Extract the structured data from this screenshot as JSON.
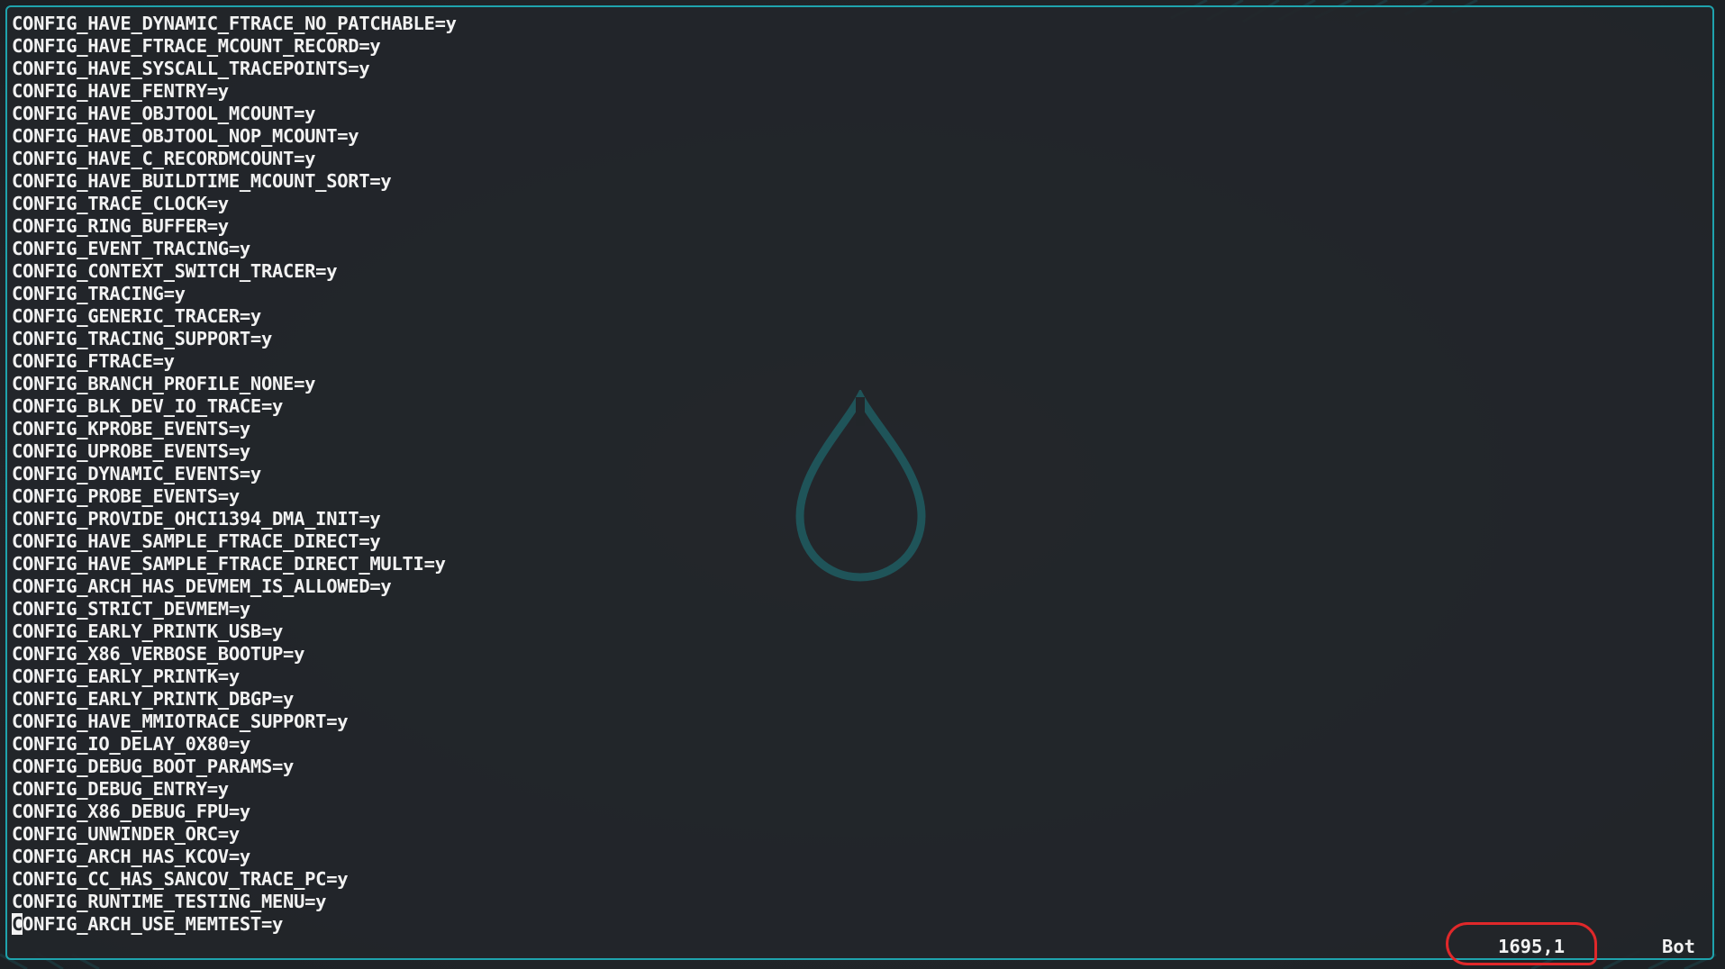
{
  "editor": {
    "lines": [
      "CONFIG_HAVE_DYNAMIC_FTRACE_NO_PATCHABLE=y",
      "CONFIG_HAVE_FTRACE_MCOUNT_RECORD=y",
      "CONFIG_HAVE_SYSCALL_TRACEPOINTS=y",
      "CONFIG_HAVE_FENTRY=y",
      "CONFIG_HAVE_OBJTOOL_MCOUNT=y",
      "CONFIG_HAVE_OBJTOOL_NOP_MCOUNT=y",
      "CONFIG_HAVE_C_RECORDMCOUNT=y",
      "CONFIG_HAVE_BUILDTIME_MCOUNT_SORT=y",
      "CONFIG_TRACE_CLOCK=y",
      "CONFIG_RING_BUFFER=y",
      "CONFIG_EVENT_TRACING=y",
      "CONFIG_CONTEXT_SWITCH_TRACER=y",
      "CONFIG_TRACING=y",
      "CONFIG_GENERIC_TRACER=y",
      "CONFIG_TRACING_SUPPORT=y",
      "CONFIG_FTRACE=y",
      "CONFIG_BRANCH_PROFILE_NONE=y",
      "CONFIG_BLK_DEV_IO_TRACE=y",
      "CONFIG_KPROBE_EVENTS=y",
      "CONFIG_UPROBE_EVENTS=y",
      "CONFIG_DYNAMIC_EVENTS=y",
      "CONFIG_PROBE_EVENTS=y",
      "CONFIG_PROVIDE_OHCI1394_DMA_INIT=y",
      "CONFIG_HAVE_SAMPLE_FTRACE_DIRECT=y",
      "CONFIG_HAVE_SAMPLE_FTRACE_DIRECT_MULTI=y",
      "CONFIG_ARCH_HAS_DEVMEM_IS_ALLOWED=y",
      "CONFIG_STRICT_DEVMEM=y",
      "CONFIG_EARLY_PRINTK_USB=y",
      "CONFIG_X86_VERBOSE_BOOTUP=y",
      "CONFIG_EARLY_PRINTK=y",
      "CONFIG_EARLY_PRINTK_DBGP=y",
      "CONFIG_HAVE_MMIOTRACE_SUPPORT=y",
      "CONFIG_IO_DELAY_0X80=y",
      "CONFIG_DEBUG_BOOT_PARAMS=y",
      "CONFIG_DEBUG_ENTRY=y",
      "CONFIG_X86_DEBUG_FPU=y",
      "CONFIG_UNWINDER_ORC=y",
      "CONFIG_ARCH_HAS_KCOV=y",
      "CONFIG_CC_HAS_SANCOV_TRACE_PC=y",
      "CONFIG_RUNTIME_TESTING_MENU=y"
    ],
    "cursor_line": {
      "cursor_char": "C",
      "rest": "ONFIG_ARCH_USE_MEMTEST=y"
    }
  },
  "statusbar": {
    "position": "1695,1",
    "scroll": "Bot"
  },
  "colors": {
    "frame_border": "#1fa3ad",
    "text": "#f2f2f2",
    "highlight_ring": "#e0282a"
  },
  "icons": {
    "watermark": "droplet-logo-icon"
  }
}
